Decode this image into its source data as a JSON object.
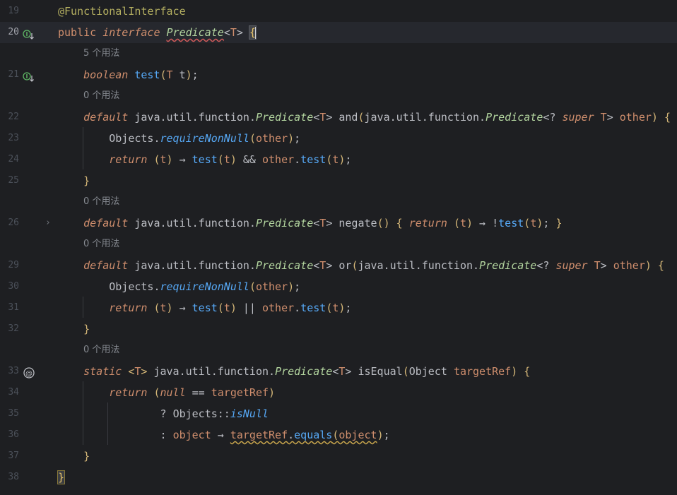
{
  "editor": {
    "lines": [
      {
        "num": "19",
        "kind": "code",
        "tokens": [
          {
            "t": "@FunctionalInterface",
            "c": "ann"
          }
        ]
      },
      {
        "num": "20",
        "kind": "code",
        "current": true,
        "icon": "implemented-down-icon",
        "tokens": [
          {
            "t": "public ",
            "c": "kw"
          },
          {
            "t": "interface ",
            "c": "kwi"
          },
          {
            "t": "Predicate",
            "c": "itype squig"
          },
          {
            "t": "<",
            "c": "plain"
          },
          {
            "t": "T",
            "c": "tp"
          },
          {
            "t": "> ",
            "c": "plain"
          },
          {
            "t": "{",
            "c": "brace-hl"
          }
        ]
      },
      {
        "kind": "hint",
        "text": "5 个用法"
      },
      {
        "num": "21",
        "kind": "code",
        "icon": "implemented-down-icon",
        "tokens": [
          {
            "t": "    boolean ",
            "c": "kwi"
          },
          {
            "t": "test",
            "c": "fn"
          },
          {
            "t": "(",
            "c": "paren-y"
          },
          {
            "t": "T ",
            "c": "tp"
          },
          {
            "t": "t",
            "c": "plain"
          },
          {
            "t": ")",
            "c": "paren-y"
          },
          {
            "t": ";",
            "c": "plain"
          }
        ]
      },
      {
        "kind": "hint",
        "text": "0 个用法"
      },
      {
        "num": "22",
        "kind": "code",
        "tokens": [
          {
            "t": "    default ",
            "c": "kwi"
          },
          {
            "t": "java.util.function.",
            "c": "plain"
          },
          {
            "t": "Predicate",
            "c": "itype"
          },
          {
            "t": "<",
            "c": "plain"
          },
          {
            "t": "T",
            "c": "tp"
          },
          {
            "t": "> ",
            "c": "plain"
          },
          {
            "t": "and",
            "c": "plain"
          },
          {
            "t": "(",
            "c": "paren-y"
          },
          {
            "t": "java.util.function.",
            "c": "plain"
          },
          {
            "t": "Predicate",
            "c": "itype"
          },
          {
            "t": "<? ",
            "c": "plain"
          },
          {
            "t": "super ",
            "c": "kwi"
          },
          {
            "t": "T",
            "c": "tp"
          },
          {
            "t": "> ",
            "c": "plain"
          },
          {
            "t": "other",
            "c": "param"
          },
          {
            "t": ") {",
            "c": "paren-y"
          }
        ]
      },
      {
        "num": "23",
        "kind": "code",
        "tokens": [
          {
            "t": "        Objects.",
            "c": "plain"
          },
          {
            "t": "requireNonNull",
            "c": "static-call"
          },
          {
            "t": "(",
            "c": "paren-y"
          },
          {
            "t": "other",
            "c": "param"
          },
          {
            "t": ")",
            "c": "paren-y"
          },
          {
            "t": ";",
            "c": "plain"
          }
        ]
      },
      {
        "num": "24",
        "kind": "code",
        "tokens": [
          {
            "t": "        return ",
            "c": "kwi"
          },
          {
            "t": "(",
            "c": "paren-y"
          },
          {
            "t": "t",
            "c": "lambda-p"
          },
          {
            "t": ")",
            "c": "paren-y"
          },
          {
            "t": " → ",
            "c": "plain"
          },
          {
            "t": "test",
            "c": "fncall"
          },
          {
            "t": "(",
            "c": "paren-y"
          },
          {
            "t": "t",
            "c": "lambda-p"
          },
          {
            "t": ")",
            "c": "paren-y"
          },
          {
            "t": " && ",
            "c": "plain"
          },
          {
            "t": "other",
            "c": "param"
          },
          {
            "t": ".",
            "c": "plain"
          },
          {
            "t": "test",
            "c": "fncall"
          },
          {
            "t": "(",
            "c": "paren-y"
          },
          {
            "t": "t",
            "c": "lambda-p"
          },
          {
            "t": ")",
            "c": "paren-y"
          },
          {
            "t": ";",
            "c": "plain"
          }
        ]
      },
      {
        "num": "25",
        "kind": "code",
        "tokens": [
          {
            "t": "    }",
            "c": "paren-y"
          }
        ]
      },
      {
        "kind": "hint",
        "text": "0 个用法"
      },
      {
        "num": "26",
        "kind": "code",
        "fold": true,
        "tokens": [
          {
            "t": "    default ",
            "c": "kwi"
          },
          {
            "t": "java.util.function.",
            "c": "plain"
          },
          {
            "t": "Predicate",
            "c": "itype"
          },
          {
            "t": "<",
            "c": "plain"
          },
          {
            "t": "T",
            "c": "tp"
          },
          {
            "t": "> ",
            "c": "plain"
          },
          {
            "t": "negate",
            "c": "plain"
          },
          {
            "t": "() { ",
            "c": "paren-y"
          },
          {
            "t": "return ",
            "c": "kwi"
          },
          {
            "t": "(",
            "c": "paren-y"
          },
          {
            "t": "t",
            "c": "lambda-p"
          },
          {
            "t": ")",
            "c": "paren-y"
          },
          {
            "t": " → !",
            "c": "plain"
          },
          {
            "t": "test",
            "c": "fncall"
          },
          {
            "t": "(",
            "c": "paren-y"
          },
          {
            "t": "t",
            "c": "lambda-p"
          },
          {
            "t": ")",
            "c": "paren-y"
          },
          {
            "t": "; ",
            "c": "plain"
          },
          {
            "t": "}",
            "c": "paren-y"
          }
        ]
      },
      {
        "kind": "hint",
        "text": "0 个用法"
      },
      {
        "num": "29",
        "kind": "code",
        "tokens": [
          {
            "t": "    default ",
            "c": "kwi"
          },
          {
            "t": "java.util.function.",
            "c": "plain"
          },
          {
            "t": "Predicate",
            "c": "itype"
          },
          {
            "t": "<",
            "c": "plain"
          },
          {
            "t": "T",
            "c": "tp"
          },
          {
            "t": "> ",
            "c": "plain"
          },
          {
            "t": "or",
            "c": "plain"
          },
          {
            "t": "(",
            "c": "paren-y"
          },
          {
            "t": "java.util.function.",
            "c": "plain"
          },
          {
            "t": "Predicate",
            "c": "itype"
          },
          {
            "t": "<? ",
            "c": "plain"
          },
          {
            "t": "super ",
            "c": "kwi"
          },
          {
            "t": "T",
            "c": "tp"
          },
          {
            "t": "> ",
            "c": "plain"
          },
          {
            "t": "other",
            "c": "param"
          },
          {
            "t": ") {",
            "c": "paren-y"
          }
        ]
      },
      {
        "num": "30",
        "kind": "code",
        "tokens": [
          {
            "t": "        Objects.",
            "c": "plain"
          },
          {
            "t": "requireNonNull",
            "c": "static-call"
          },
          {
            "t": "(",
            "c": "paren-y"
          },
          {
            "t": "other",
            "c": "param"
          },
          {
            "t": ")",
            "c": "paren-y"
          },
          {
            "t": ";",
            "c": "plain"
          }
        ]
      },
      {
        "num": "31",
        "kind": "code",
        "tokens": [
          {
            "t": "        return ",
            "c": "kwi"
          },
          {
            "t": "(",
            "c": "paren-y"
          },
          {
            "t": "t",
            "c": "lambda-p"
          },
          {
            "t": ")",
            "c": "paren-y"
          },
          {
            "t": " → ",
            "c": "plain"
          },
          {
            "t": "test",
            "c": "fncall"
          },
          {
            "t": "(",
            "c": "paren-y"
          },
          {
            "t": "t",
            "c": "lambda-p"
          },
          {
            "t": ")",
            "c": "paren-y"
          },
          {
            "t": " || ",
            "c": "plain"
          },
          {
            "t": "other",
            "c": "param"
          },
          {
            "t": ".",
            "c": "plain"
          },
          {
            "t": "test",
            "c": "fncall"
          },
          {
            "t": "(",
            "c": "paren-y"
          },
          {
            "t": "t",
            "c": "lambda-p"
          },
          {
            "t": ")",
            "c": "paren-y"
          },
          {
            "t": ";",
            "c": "plain"
          }
        ]
      },
      {
        "num": "32",
        "kind": "code",
        "tokens": [
          {
            "t": "    }",
            "c": "paren-y"
          }
        ]
      },
      {
        "kind": "hint",
        "text": "0 个用法"
      },
      {
        "num": "33",
        "kind": "code",
        "icon": "at-icon",
        "tokens": [
          {
            "t": "    static ",
            "c": "kwi"
          },
          {
            "t": "<",
            "c": "paren-y"
          },
          {
            "t": "T",
            "c": "tp"
          },
          {
            "t": "> ",
            "c": "paren-y"
          },
          {
            "t": "java.util.function.",
            "c": "plain"
          },
          {
            "t": "Predicate",
            "c": "itype"
          },
          {
            "t": "<",
            "c": "plain"
          },
          {
            "t": "T",
            "c": "tp"
          },
          {
            "t": "> ",
            "c": "plain"
          },
          {
            "t": "isEqual",
            "c": "plain"
          },
          {
            "t": "(",
            "c": "paren-y"
          },
          {
            "t": "Object ",
            "c": "plain"
          },
          {
            "t": "targetRef",
            "c": "param"
          },
          {
            "t": ") {",
            "c": "paren-y"
          }
        ]
      },
      {
        "num": "34",
        "kind": "code",
        "tokens": [
          {
            "t": "        return ",
            "c": "kwi"
          },
          {
            "t": "(",
            "c": "paren-y"
          },
          {
            "t": "null",
            "c": "kwi"
          },
          {
            "t": " == ",
            "c": "plain"
          },
          {
            "t": "targetRef",
            "c": "param"
          },
          {
            "t": ")",
            "c": "paren-y"
          }
        ]
      },
      {
        "num": "35",
        "kind": "code",
        "tokens": [
          {
            "t": "                ? ",
            "c": "plain"
          },
          {
            "t": "Objects::",
            "c": "plain"
          },
          {
            "t": "isNull",
            "c": "static-call"
          }
        ]
      },
      {
        "num": "36",
        "kind": "code",
        "tokens": [
          {
            "t": "                : ",
            "c": "plain"
          },
          {
            "t": "object",
            "c": "lambda-p"
          },
          {
            "t": " → ",
            "c": "plain"
          },
          {
            "t": "targetRef",
            "c": "param squig-y"
          },
          {
            "t": ".",
            "c": "plain squig-y"
          },
          {
            "t": "equals",
            "c": "fncall squig-y"
          },
          {
            "t": "(",
            "c": "paren-y squig-y"
          },
          {
            "t": "object",
            "c": "lambda-p squig-y"
          },
          {
            "t": ")",
            "c": "paren-y"
          },
          {
            "t": ";",
            "c": "plain"
          }
        ]
      },
      {
        "num": "37",
        "kind": "code",
        "tokens": [
          {
            "t": "    }",
            "c": "paren-y"
          }
        ]
      },
      {
        "num": "38",
        "kind": "code",
        "tokens": [
          {
            "t": "}",
            "c": "brace-end"
          }
        ]
      }
    ]
  }
}
